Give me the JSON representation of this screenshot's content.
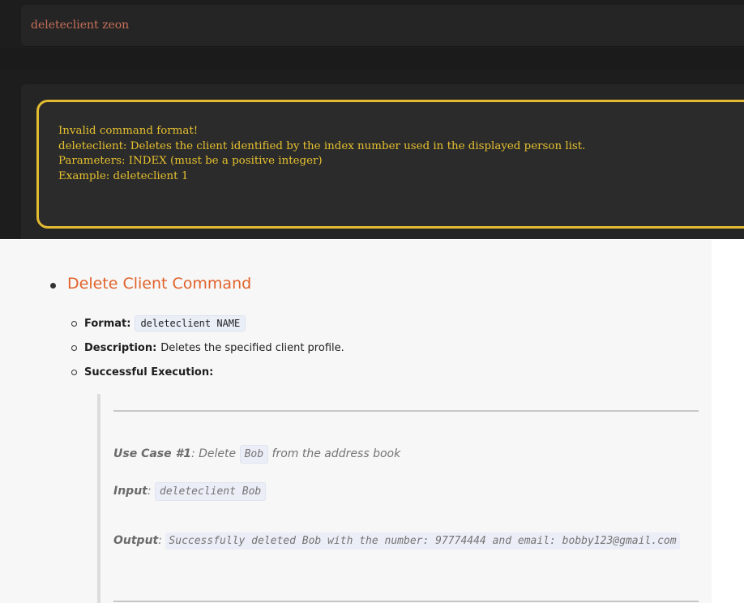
{
  "terminal": {
    "command_input": "deleteclient zeon",
    "result_lines": [
      "Invalid command format!",
      "deleteclient: Deletes the client identified by the index number used in the displayed person list.",
      "Parameters: INDEX (must be a positive integer)",
      "Example: deleteclient 1"
    ]
  },
  "docs": {
    "heading": "Delete Client Command",
    "format_label": "Format:",
    "format_value": "deleteclient NAME",
    "description_label": "Description:",
    "description_value": "Deletes the specified client profile.",
    "execution_label": "Successful Execution:",
    "use_case_label": "Use Case #1",
    "use_case_prefix": ": Delete ",
    "use_case_code": "Bob",
    "use_case_suffix": " from the address book",
    "input_label": "Input",
    "input_sep": ": ",
    "input_code": "deleteclient Bob",
    "output_label": "Output",
    "output_sep": ": ",
    "output_code": "Successfully deleted Bob with the number: 97774444 and email: bobby123@gmail.com"
  },
  "colors": {
    "command_text": "#c9705a",
    "error_border": "#e3bb32",
    "error_text": "#e5c02f",
    "heading": "#e0622a"
  }
}
